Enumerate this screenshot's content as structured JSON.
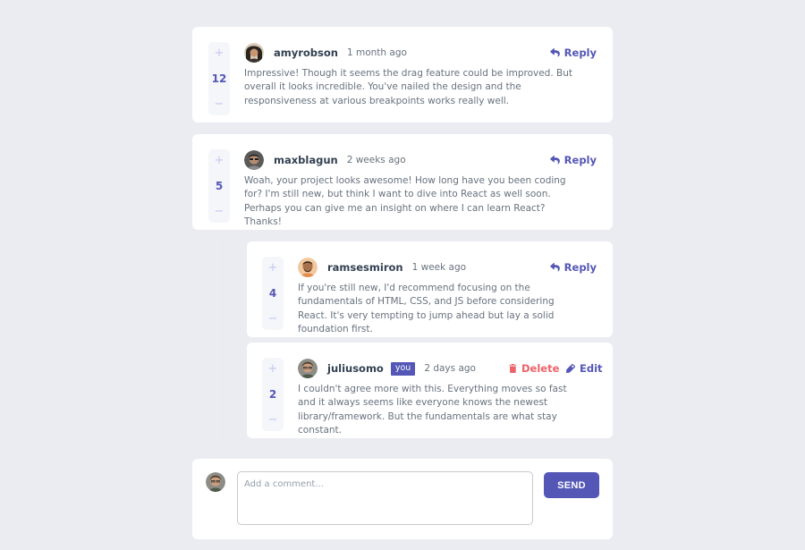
{
  "comments": [
    {
      "score": "12",
      "username": "amyrobson",
      "time": "1 month ago",
      "content": "Impressive! Though it seems the drag feature could be improved. But overall it looks incredible. You've nailed the design and the responsiveness at various breakpoints works really well.",
      "reply_label": "Reply"
    },
    {
      "score": "5",
      "username": "maxblagun",
      "time": "2 weeks ago",
      "content": "Woah, your project looks awesome! How long have you been coding for? I'm still new, but think I want to dive into React as well soon. Perhaps you can give me an insight on where I can learn React? Thanks!",
      "reply_label": "Reply"
    }
  ],
  "replies": [
    {
      "score": "4",
      "username": "ramsesmiron",
      "time": "1 week ago",
      "content": "If you're still new, I'd recommend focusing on the fundamentals of HTML, CSS, and JS before considering React. It's very tempting to jump ahead but lay a solid foundation first.",
      "reply_label": "Reply"
    },
    {
      "score": "2",
      "username": "juliusomo",
      "you_badge": "you",
      "time": "2 days ago",
      "content": "I couldn't agree more with this. Everything moves so fast and it always seems like everyone knows the newest library/framework. But the fundamentals are what stay constant.",
      "delete_label": "Delete",
      "edit_label": "Edit"
    }
  ],
  "composer": {
    "placeholder": "Add a comment...",
    "send_label": "SEND"
  },
  "colors": {
    "primary": "#5457b6",
    "danger": "#ed6368",
    "background": "#eaecf1",
    "vote_bg": "#f5f6fa"
  },
  "icons": {
    "upvote": "plus-icon",
    "downvote": "minus-icon",
    "reply": "reply-arrow-icon",
    "delete": "trash-icon",
    "edit": "pencil-icon"
  }
}
